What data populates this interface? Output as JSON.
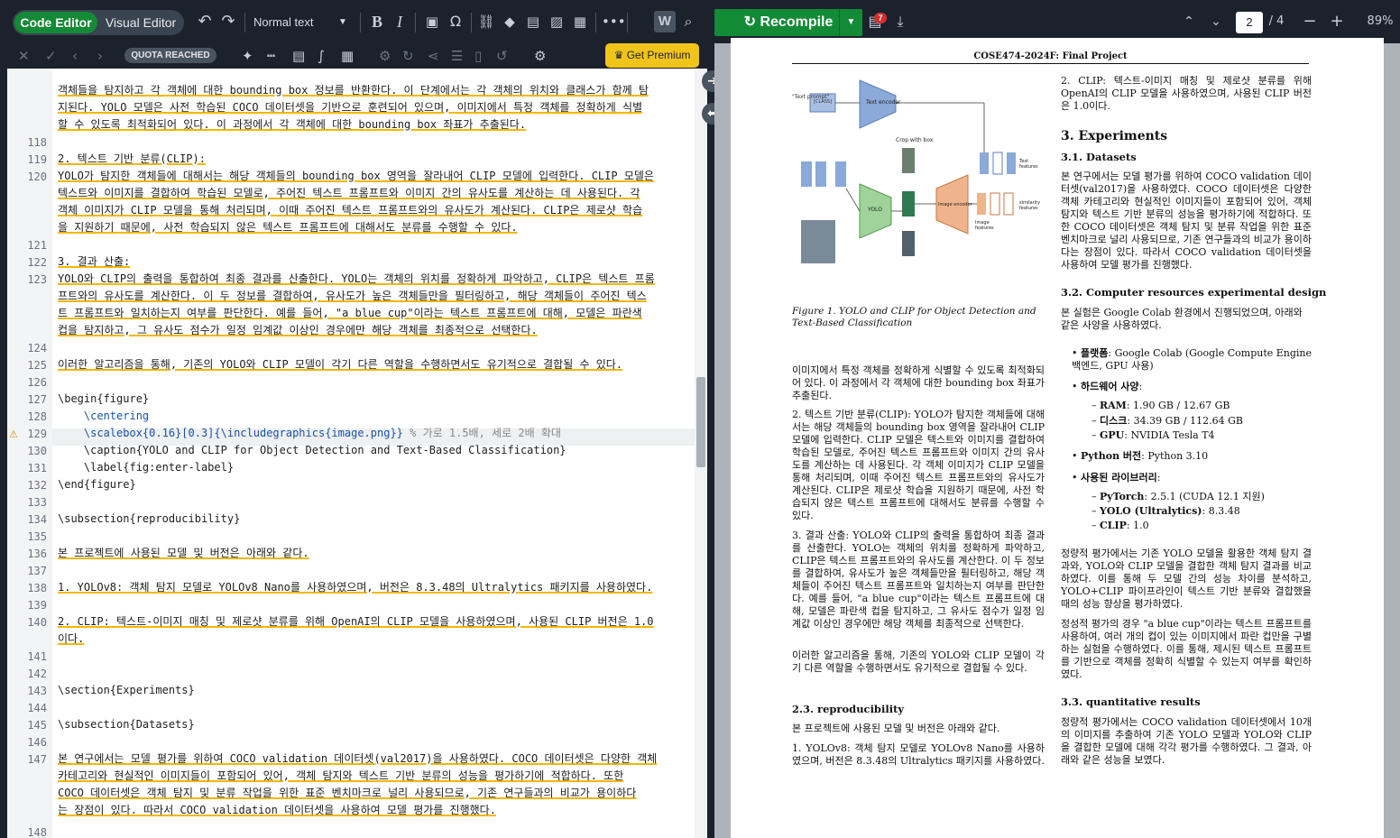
{
  "toolbar": {
    "code_editor": "Code Editor",
    "visual_editor": "Visual Editor",
    "text_style": "Normal text",
    "quota": "QUOTA REACHED",
    "premium": "Get Premium",
    "premium_icon": "crown-icon"
  },
  "pdf_toolbar": {
    "recompile": "Recompile",
    "badge_count": "7",
    "page_current": "2",
    "page_total": "/ 4",
    "zoom": "89%"
  },
  "editor": {
    "line_numbers": {
      "l118": "118",
      "l119": "119",
      "l120": "120",
      "l121": "121",
      "l122": "122",
      "l123": "123",
      "l124": "124",
      "l125": "125",
      "l126": "126",
      "l127": "127",
      "l128": "128",
      "l129": "129",
      "l130": "130",
      "l131": "131",
      "l132": "132",
      "l133": "133",
      "l134": "134",
      "l135": "135",
      "l136": "136",
      "l137": "137",
      "l138": "138",
      "l139": "139",
      "l140": "140",
      "l141": "141",
      "l142": "142",
      "l143": "143",
      "l144": "144",
      "l145": "145",
      "l146": "146",
      "l147": "147",
      "l148": "148"
    },
    "text": {
      "c117a": "객체들을 탐지하고 각 객체에 대한 bounding box 정보를 반환한다. 이 단계에서는 각 객체의 위치와 클래스가 함께 탐",
      "c117b": "지된다. YOLO 모델은 사전 학습된 COCO 데이터셋을 기반으로 훈련되어 있으며, 이미지에서 특정 객체를 정확하게 식별",
      "c117c": "할 수 있도록 최적화되어 있다. 이 과정에서 각 객체에 대한 bounding box 좌표가 추출된다.",
      "c119": "2. 텍스트 기반 분류(CLIP):",
      "c120a": "YOLO가 탐지한 객체들에 대해서는 해당 객체들의 bounding box 영역을 잘라내어 CLIP 모델에 입력한다. CLIP 모델은",
      "c120b": "텍스트와 이미지를 결합하여 학습된 모델로, 주어진 텍스트 프롬프트와 이미지 간의 유사도를 계산하는 데 사용된다. 각",
      "c120c": "객체 이미지가 CLIP 모델을 통해 처리되며, 이때 주어진 텍스트 프롬프트와의 유사도가 계산된다. CLIP은 제로샷 학습",
      "c120d": "을 지원하기 때문에, 사전 학습되지 않은 텍스트 프롬프트에 대해서도 분류를 수행할 수 있다.",
      "c122": "3. 결과 산출:",
      "c123a": "YOLO와 CLIP의 출력을 통합하여 최종 결과를 산출한다. YOLO는 객체의 위치를 정확하게 파악하고, CLIP은 텍스트 프롬",
      "c123b": "프트와의 유사도를 계산한다. 이 두 정보를 결합하여, 유사도가 높은 객체들만을 필터링하고, 해당 객체들이 주어진 텍스",
      "c123c": "트 프롬프트와 일치하는지 여부를 판단한다. 예를 들어, \"a blue cup\"이라는 텍스트 프롬프트에 대해, 모델은 파란색",
      "c123d": "컵을 탐지하고, 그 유사도 점수가 일정 임계값 이상인 경우에만 해당 객체를 최종적으로 선택한다.",
      "c125": "이러한 알고리즘을 통해, 기존의 YOLO와 CLIP 모델이 각기 다른 역할을 수행하면서도 유기적으로 결합될 수 있다.",
      "c127": "\\begin{figure}",
      "c128": "    \\centering",
      "c129a": "    \\scalebox{0.16}[0.3]{\\includegraphics{image.png}}",
      "c129b": " % 가로 1.5배, 세로 2배 확대",
      "c130": "    \\caption{YOLO and CLIP for Object Detection and Text-Based Classification}",
      "c131": "    \\label{fig:enter-label}",
      "c132": "\\end{figure}",
      "c134": "\\subsection{reproducibility}",
      "c136": "본 프로젝트에 사용된 모델 및 버전은 아래와 같다.",
      "c138": "1. YOLOv8: 객체 탐지 모델로 YOLOv8 Nano를 사용하였으며, 버전은 8.3.48의 Ultralytics 패키지를 사용하였다.",
      "c140a": "2. CLIP: 텍스트-이미지 매칭 및 제로샷 분류를 위해 OpenAI의 CLIP 모델을 사용하였으며, 사용된 CLIP 버전은 1.0",
      "c140b": "이다.",
      "c143": "\\section{Experiments}",
      "c145": "\\subsection{Datasets}",
      "c147a": "본 연구에서는 모델 평가를 위하여 COCO validation 데이터셋(val2017)을 사용하였다. COCO 데이터셋은 다양한 객체",
      "c147b": "카테고리와 현실적인 이미지들이 포함되어 있어, 객체 탐지와 텍스트 기반 분류의 성능을 평가하기에 적합하다. 또한",
      "c147c": "COCO 데이터셋은 객체 탐지 및 분류 작업을 위한 표준 벤치마크로 널리 사용되므로, 기존 연구들과의 비교가 용이하다",
      "c147d": "는 장점이 있다. 따라서 COCO validation 데이터셋을 사용하여 모델 평가를 진행했다."
    }
  },
  "pdf": {
    "header": "COSE474-2024F: Final Project",
    "fig_caption": "Figure 1. YOLO and CLIP for Object Detection and Text-Based Classification",
    "fig_labels": {
      "text_prompt": "\"Text prompt\"",
      "clip": "[CLASS]",
      "text_encoder": "Text encoder",
      "crop": "Crop with box",
      "yolo": "YOLO",
      "image_encoder": "Image encoder",
      "text_features": "Text features",
      "image_features": "Image features",
      "similarity": "similarity features"
    },
    "left": {
      "p1": "이미지에서 특정 객체를 정확하게 식별할 수 있도록 최적화되어 있다. 이 과정에서 각 객체에 대한 bounding box 좌표가 추출된다.",
      "p2": "2. 텍스트 기반 분류(CLIP): YOLO가 탐지한 객체들에 대해서는 해당 객체들의 bounding box 영역을 잘라내어 CLIP 모델에 입력한다. CLIP 모델은 텍스트와 이미지를 결합하여 학습된 모델로, 주어진 텍스트 프롬프트와 이미지 간의 유사도를 계산하는 데 사용된다. 각 객체 이미지가 CLIP 모델을 통해 처리되며, 이때 주어진 텍스트 프롬프트와의 유사도가 계산된다. CLIP은 제로샷 학습을 지원하기 때문에, 사전 학습되지 않은 텍스트 프롬프트에 대해서도 분류를 수행할 수 있다.",
      "p3": "3. 결과 산출: YOLO와 CLIP의 출력을 통합하여 최종 결과를 산출한다. YOLO는 객체의 위치를 정확하게 파악하고, CLIP은 텍스트 프롬프트와의 유사도를 계산한다. 이 두 정보를 결합하여, 유사도가 높은 객체들만을 필터링하고, 해당 객체들이 주어진 텍스트 프롬프트와 일치하는지 여부를 판단한다. 예를 들어, \"a blue cup\"이라는 텍스트 프롬프트에 대해, 모델은 파란색 컵을 탐지하고, 그 유사도 점수가 일정 임계값 이상인 경우에만 해당 객체를 최종적으로 선택한다.",
      "p4": "이러한 알고리즘을 통해, 기존의 YOLO와 CLIP 모델이 각기 다른 역할을 수행하면서도 유기적으로 결합될 수 있다.",
      "h_repro": "2.3. reproducibility",
      "p5": "본 프로젝트에 사용된 모델 및 버전은 아래와 같다.",
      "p6": "1. YOLOv8: 객체 탐지 모델로 YOLOv8 Nano를 사용하였으며, 버전은 8.3.48의 Ultralytics 패키지를 사용하였다."
    },
    "right": {
      "p_clip": "2. CLIP: 텍스트-이미지 매칭 및 제로샷 분류를 위해 OpenAI의 CLIP 모델을 사용하였으며, 사용된 CLIP 버전은 1.0이다.",
      "h_exp": "3. Experiments",
      "h_datasets": "3.1. Datasets",
      "p_datasets": "본 연구에서는 모델 평가를 위하여 COCO validation 데이터셋(val2017)을 사용하였다. COCO 데이터셋은 다양한 객체 카테고리와 현실적인 이미지들이 포함되어 있어, 객체 탐지와 텍스트 기반 분류의 성능을 평가하기에 적합하다. 또한 COCO 데이터셋은 객체 탐지 및 분류 작업을 위한 표준 벤치마크로 널리 사용되므로, 기존 연구들과의 비교가 용이하다는 장점이 있다. 따라서 COCO validation 데이터셋을 사용하여 모델 평가를 진행했다.",
      "h_compute": "3.2. Computer resources  experimental design",
      "p_compute": "본 실험은 Google Colab 환경에서 진행되었으며, 아래와 같은 사양을 사용하였다.",
      "b_platform_label": "플랫폼",
      "b_platform": ": Google Colab (Google Compute Engine 백엔드, GPU 사용)",
      "b_hw_label": "하드웨어 사양",
      "b_hw": ":",
      "ram_label": "RAM",
      "ram": ": 1.90 GB / 12.67 GB",
      "disk_label": "디스크",
      "disk": ": 34.39 GB / 112.64 GB",
      "gpu_label": "GPU",
      "gpu": ": NVIDIA Tesla T4",
      "py_label": "Python 버전",
      "py": ": Python 3.10",
      "lib_label": "사용된 라이브러리",
      "lib": ":",
      "torch_label": "PyTorch",
      "torch": ": 2.5.1 (CUDA 12.1 지원)",
      "yolo_label": "YOLO (Ultralytics)",
      "yolo": ": 8.3.48",
      "clip_label": "CLIP",
      "clip": ": 1.0",
      "p_quant": "정량적 평가에서는 기존 YOLO 모델을 활용한 객체 탐지 결과와, YOLO와 CLIP 모델을 결합한 객체 탐지 결과를 비교하였다. 이를 통해 두 모델 간의 성능 차이를 분석하고, YOLO+CLIP 파이프라인이 텍스트 기반 분류와 결합했을 때의 성능 향상을 평가하였다.",
      "p_qual": "정성적 평가의 경우 \"a blue cup\"이라는 텍스트 프롬프트를 사용하여, 여러 개의 컵이 있는 이미지에서 파란 컵만을 구별하는 실험을 수행하였다. 이를 통해, 제시된 텍스트 프롬프트를 기반으로 객체를 정확히 식별할 수 있는지 여부를 확인하였다.",
      "h_quant": "3.3. quantitative results",
      "p_results": "정량적 평가에서는 COCO validation 데이터셋에서 10개의 이미지를 추출하여 기존 YOLO 모델과 YOLO와 CLIP을 결합한 모델에 대해 각각 평가를 수행하였다. 그 결과, 아래와 같은 성능을 보였다."
    }
  }
}
